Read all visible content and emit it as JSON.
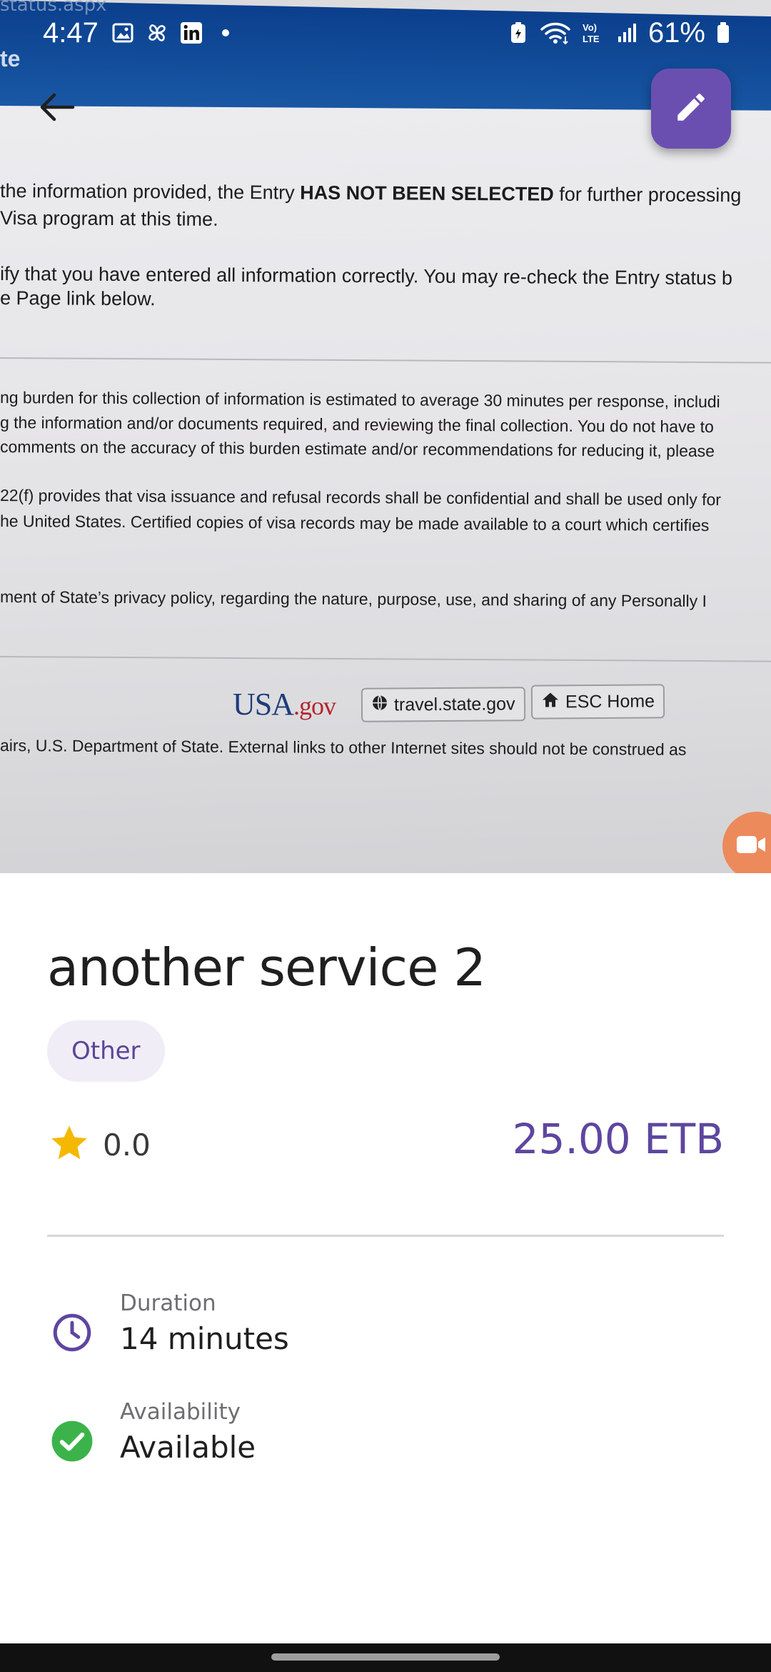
{
  "status_bar": {
    "time": "4:47",
    "battery": "61%",
    "icons_left": [
      "gallery-icon",
      "pinwheel-icon",
      "linkedin-icon",
      "dot-icon"
    ],
    "icons_right": [
      "battery-saver-icon",
      "wifi-icon",
      "volte-icon",
      "signal-icon",
      "battery-icon"
    ]
  },
  "photo": {
    "url_fragment": "status.aspx",
    "site_fragment": "te",
    "lines": [
      {
        "pre": "the information provided, the Entry ",
        "bold": "HAS NOT BEEN SELECTED",
        "post": " for further processing"
      },
      {
        "text": "Visa program at this time."
      },
      {
        "text": "ify that you have entered all information correctly. You may re-check the Entry status b"
      },
      {
        "text": "e Page link below."
      },
      {
        "text": "ng burden for this collection of information is estimated to average 30 minutes per response, includi"
      },
      {
        "text": "g the information and/or documents required, and reviewing the final collection. You do not have to"
      },
      {
        "text": "comments on the accuracy of this burden estimate and/or recommendations for reducing it, please"
      },
      {
        "text": "22(f) provides that visa issuance and refusal records shall be confidential and shall be used only for"
      },
      {
        "text": "he United States. Certified copies of visa records may be made available to a court which certifies"
      },
      {
        "text": "ment of State’s privacy policy, regarding the nature, purpose, use, and sharing of any Personally I"
      },
      {
        "text": "airs, U.S. Department of State. External links to other Internet sites should not be construed as"
      }
    ],
    "logo": {
      "usa": "USA",
      "gov": ".gov"
    },
    "link_travel": "travel.state.gov",
    "link_home": "ESC Home"
  },
  "service": {
    "title": "another service 2",
    "category": "Other",
    "rating": "0.0",
    "price": "25.00 ETB",
    "duration_label": "Duration",
    "duration_value": "14 minutes",
    "availability_label": "Availability",
    "availability_value": "Available"
  },
  "colors": {
    "accent": "#6b4fb0",
    "price": "#5e469f",
    "star": "#f5b800",
    "available": "#3bb34a",
    "video_fab": "#ec8a5c"
  }
}
